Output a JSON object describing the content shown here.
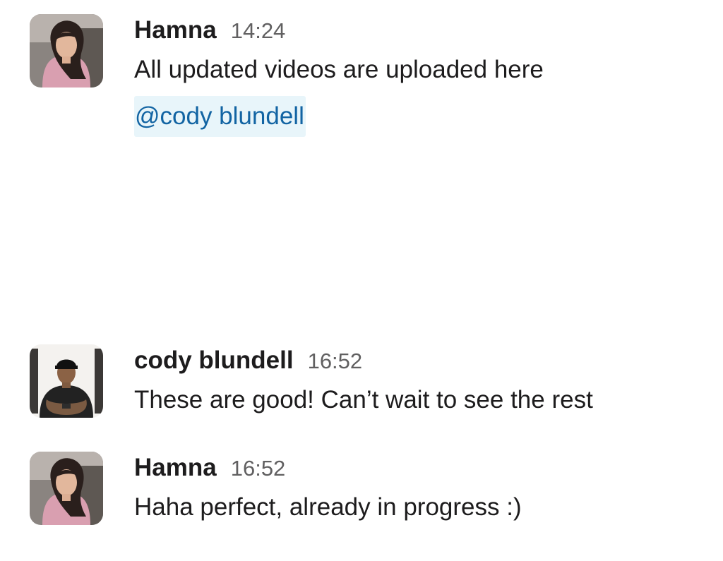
{
  "messages": [
    {
      "author": "Hamna",
      "time": "14:24",
      "text": "All updated videos are uploaded here",
      "mention": "@cody blundell"
    },
    {
      "author": "cody blundell",
      "time": "16:52",
      "text": "These are good! Can’t wait to see the rest"
    },
    {
      "author": "Hamna",
      "time": "16:52",
      "text": "Haha perfect, already in progress :)"
    }
  ],
  "colors": {
    "text": "#1d1c1d",
    "timestamp": "#616061",
    "mention_text": "#1264a3",
    "mention_background": "#e8f5fa"
  },
  "icons": {
    "hamna_avatar": "avatar-photo-hamna",
    "cody_avatar": "avatar-photo-cody"
  }
}
